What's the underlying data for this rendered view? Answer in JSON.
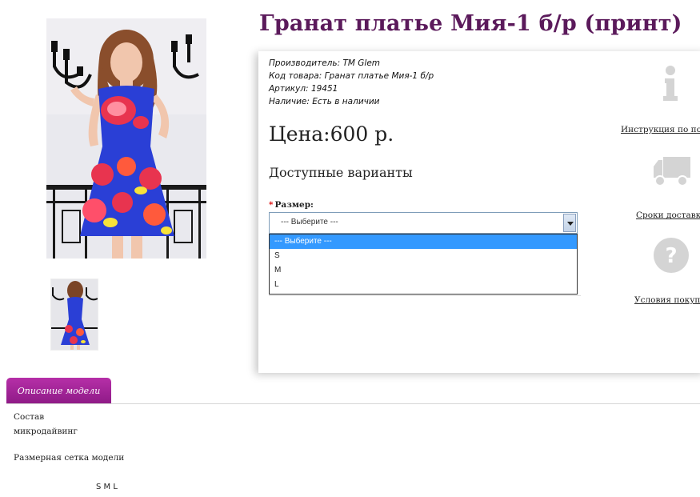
{
  "product": {
    "title": "Гранат платье Мия-1 б/р (принт)",
    "manufacturer_label": "Производитель:",
    "manufacturer": "ТМ Glem",
    "code_label": "Код товара:",
    "code": "Гранат платье Мия-1 б/р",
    "article_label": "Артикул:",
    "article": "19451",
    "availability_label": "Наличие:",
    "availability": "Есть в наличии",
    "price": "Цена:600 р."
  },
  "variants": {
    "title": "Доступные варианты",
    "size_label": "Размер:",
    "select_value": "--- Выберите ---",
    "options": [
      "--- Выберите ---",
      "S",
      "M",
      "L"
    ]
  },
  "side_links": {
    "instruction": "Инструкция по покупке",
    "delivery": "Сроки доставки",
    "terms": "Условия покупки"
  },
  "tabs": {
    "description": "Описание модели"
  },
  "description": {
    "composition_label": "Состав",
    "composition": "микродайвинг",
    "size_chart_label": "Размерная сетка модели",
    "sizes": "S  M  L"
  },
  "colors": {
    "title": "#5b1a5b",
    "tab": "#a0239a",
    "dress_blue": "#2a3fd6",
    "pomegranate": "#e8344f",
    "icon_gray": "#d4d4d4"
  },
  "icons": [
    "info-icon",
    "truck-icon",
    "question-icon",
    "dropdown-arrow-icon"
  ]
}
